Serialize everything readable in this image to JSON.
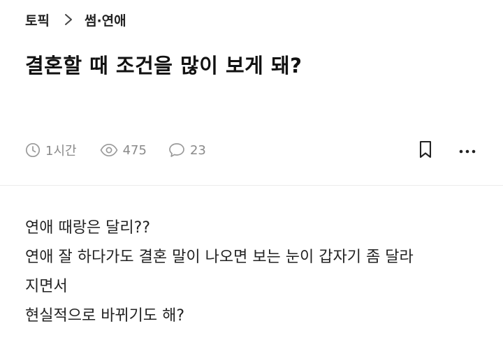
{
  "breadcrumb": {
    "topic": "토픽",
    "category": "썸·연애"
  },
  "post": {
    "title": "결혼할 때 조건을 많이 보게 돼?",
    "time": "1시간",
    "views": "475",
    "comments": "23",
    "body_lines": [
      "연애 때랑은 달리??",
      "연애 잘 하다가도 결혼 말이 나오면 보는 눈이 갑자기 좀 달라",
      "지면서",
      "현실적으로 바뀌기도 해?"
    ]
  },
  "colors": {
    "text": "#111111",
    "meta": "#8a8a8a",
    "divider": "#ececec",
    "background": "#ffffff"
  },
  "icons": {
    "chevron": "chevron-right-icon",
    "time": "clock-icon",
    "views": "eye-icon",
    "comments": "comment-icon",
    "bookmark": "bookmark-icon",
    "more": "more-vertical-icon"
  }
}
